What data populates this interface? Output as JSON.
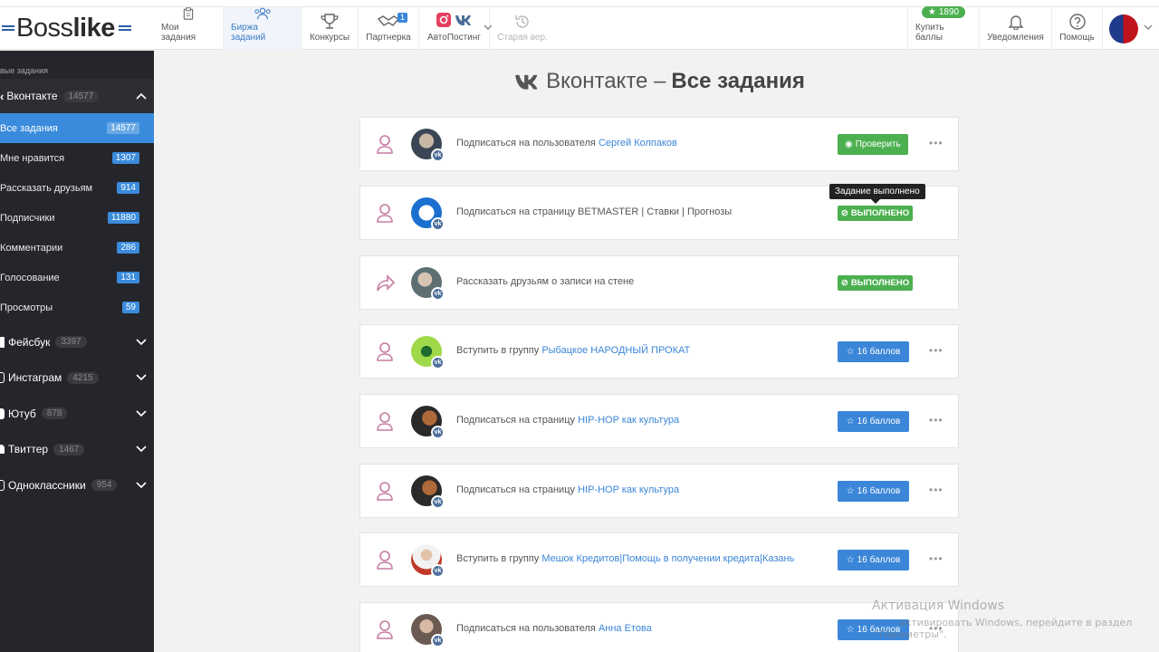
{
  "header": {
    "logo_part1": "Boss",
    "logo_part2": "like",
    "nav": [
      {
        "label": "Мои задания"
      },
      {
        "label": "Биржа заданий"
      },
      {
        "label": "Конкурсы"
      },
      {
        "label": "Партнерка",
        "badge": "1"
      },
      {
        "label": "АвтоПостинг"
      },
      {
        "label": "Старая вер."
      }
    ],
    "points": "1890",
    "buy_label": "Купить баллы",
    "notifications_label": "Уведомления",
    "help_label": "Помощь"
  },
  "sidebar": {
    "section_title": "вые задания",
    "vk": {
      "label": "Вконтакте",
      "count": "14577"
    },
    "items": [
      {
        "label": "Все задания",
        "count": "14577"
      },
      {
        "label": "Мне нравится",
        "count": "1307"
      },
      {
        "label": "Рассказать друзьям",
        "count": "914"
      },
      {
        "label": "Подписчики",
        "count": "11880"
      },
      {
        "label": "Комментарии",
        "count": "286"
      },
      {
        "label": "Голосование",
        "count": "131"
      },
      {
        "label": "Просмотры",
        "count": "59"
      }
    ],
    "groups": [
      {
        "label": "Фейсбук",
        "count": "3397"
      },
      {
        "label": "Инстаграм",
        "count": "4215"
      },
      {
        "label": "Ютуб",
        "count": "878"
      },
      {
        "label": "Твиттер",
        "count": "1467"
      },
      {
        "label": "Одноклассники",
        "count": "954"
      }
    ]
  },
  "main": {
    "title_light": "Вконтакте –",
    "title_bold": "Все задания",
    "tooltip": "Задание выполнено",
    "tasks": [
      {
        "text": "Подписаться на пользователя",
        "link": "Сергей Колпаков",
        "button": "Проверить"
      },
      {
        "text": "Подписаться на страницу BETMASTER | Ставки | Прогнозы",
        "link": "",
        "button": "ВЫПОЛНЕНО"
      },
      {
        "text": "Рассказать друзьям о записи на стене",
        "link": "",
        "button": "ВЫПОЛНЕНО"
      },
      {
        "text": "Вступить в группу",
        "link": "Рыбацкое НАРОДНЫЙ ПРОКАТ",
        "button": "16 баллов"
      },
      {
        "text": "Подписаться на страницу",
        "link": "HIP-HOP как культура",
        "button": "16 баллов"
      },
      {
        "text": "Подписаться на страницу",
        "link": "HIP-HOP как культура",
        "button": "16 баллов"
      },
      {
        "text": "Вступить в группу",
        "link": "Мешок Кредитов|Помощь в получении кредита|Казань",
        "button": "16 баллов"
      },
      {
        "text": "Подписаться на пользователя",
        "link": "Анна Етова",
        "button": "16 баллов"
      }
    ]
  },
  "watermark": {
    "line1": "Активация Windows",
    "line2": "активировать Windows, перейдите в раздел",
    "line3": "\"Параметры\"."
  },
  "colors": {
    "accent": "#3b86d8",
    "green": "#4cb050",
    "sidebar": "#25262b"
  }
}
